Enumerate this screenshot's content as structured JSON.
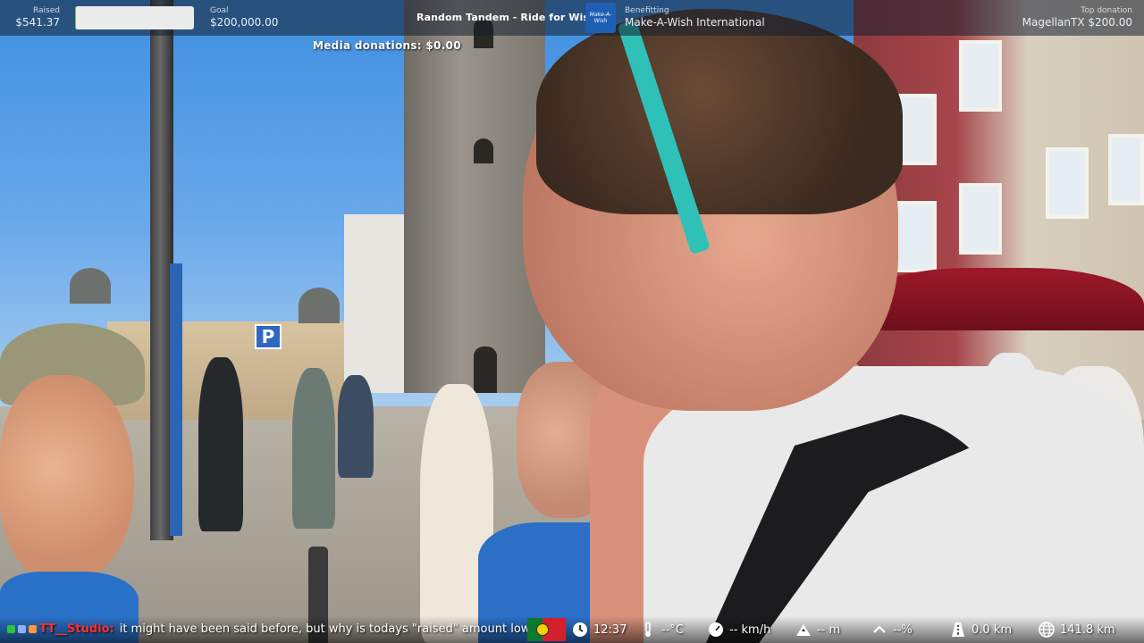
{
  "topbar": {
    "raised": {
      "label": "Raised",
      "value": "$541.37"
    },
    "progress_fraction": 0.0027,
    "goal": {
      "label": "Goal",
      "value": "$200,000.00"
    },
    "event_title": "Random Tandem - Ride for Wishes",
    "charity_logo_text": "Make-A-Wish",
    "benefitting": {
      "label": "Benefitting",
      "value": "Make-A-Wish International"
    },
    "top_donation": {
      "label": "Top donation",
      "value": "MagellanTX $200.00"
    }
  },
  "media_donations": "Media donations: $0.00",
  "scene": {
    "parking_sign": "P"
  },
  "chat": {
    "username": "TT__Studio:",
    "message": "it might have been said before, but why is todays \"raised\" amount lower"
  },
  "telemetry": {
    "time": "12:37",
    "temperature": "--°C",
    "speed": "-- km/h",
    "altitude": "-- m",
    "grade": "--%",
    "distance_today": "0.0 km",
    "distance_total": "141.8 km"
  },
  "colors": {
    "progress_fill": "#7fbf4d",
    "chat_username": "#ff3030",
    "charity_logo_bg": "#1f5fb3"
  }
}
